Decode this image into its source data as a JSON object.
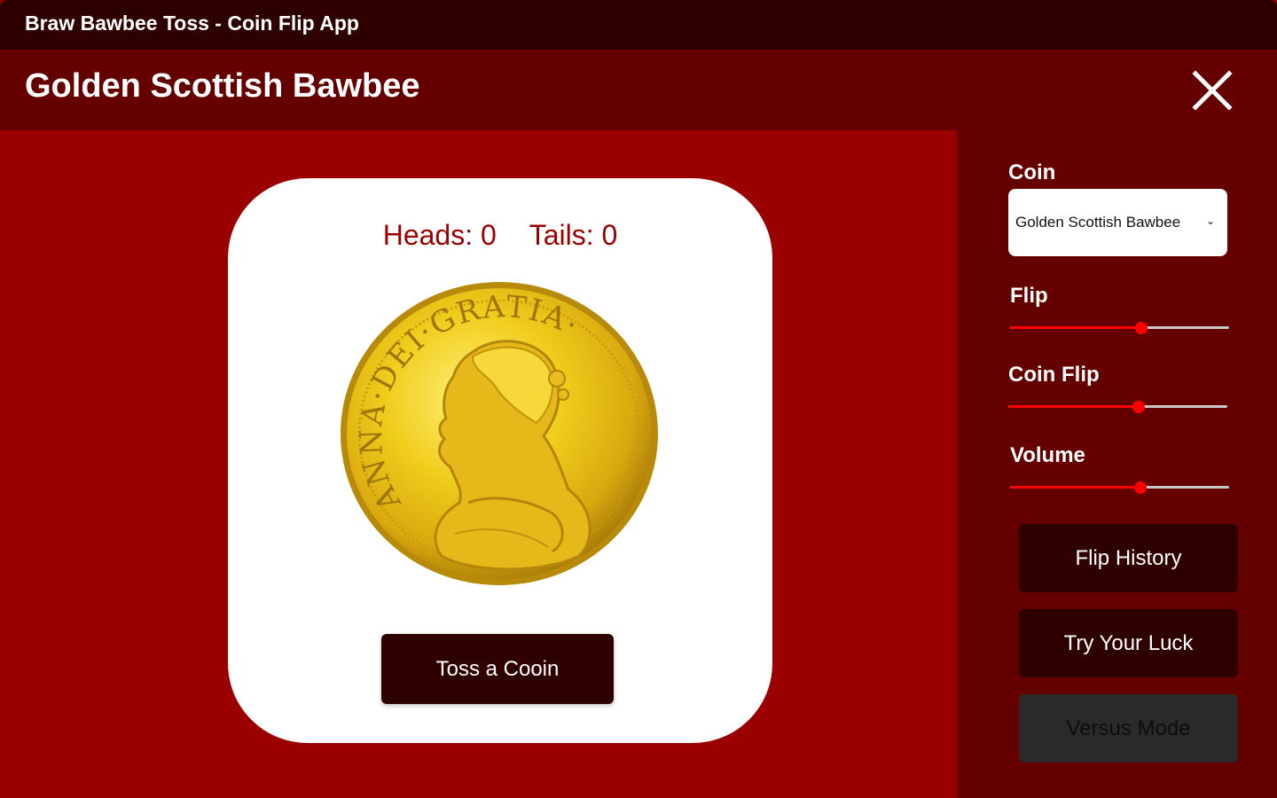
{
  "window": {
    "title": "Braw Bawbee Toss - Coin Flip App"
  },
  "header": {
    "title": "Golden Scottish Bawbee",
    "close_icon": "close-icon"
  },
  "scoreboard": {
    "heads_label": "Heads: 0",
    "tails_label": "Tails: 0"
  },
  "coin": {
    "obverse_legend": "ANNA·DEI·GRATIA·",
    "image": "gold-coin-portrait"
  },
  "toss_button": {
    "label": "Toss a Cooin"
  },
  "sidebar": {
    "coin_label": "Coin",
    "coin_select": {
      "value": "Golden Scottish Bawbee"
    },
    "sliders": [
      {
        "label": "Flip",
        "value_fraction": 0.6
      },
      {
        "label": "Coin Flip",
        "value_fraction": 0.595
      },
      {
        "label": "Volume",
        "value_fraction": 0.595
      }
    ],
    "buttons": [
      {
        "label": "Flip History",
        "enabled": true
      },
      {
        "label": "Try Your Luck",
        "enabled": true
      },
      {
        "label": "Versus Mode",
        "enabled": false
      }
    ]
  },
  "colors": {
    "titlebar": "#2e0000",
    "header": "#650000",
    "main_bg": "#9b0000",
    "accent": "#ff0000",
    "button_dark": "#2e0000",
    "button_disabled": "#2a2a2a"
  }
}
